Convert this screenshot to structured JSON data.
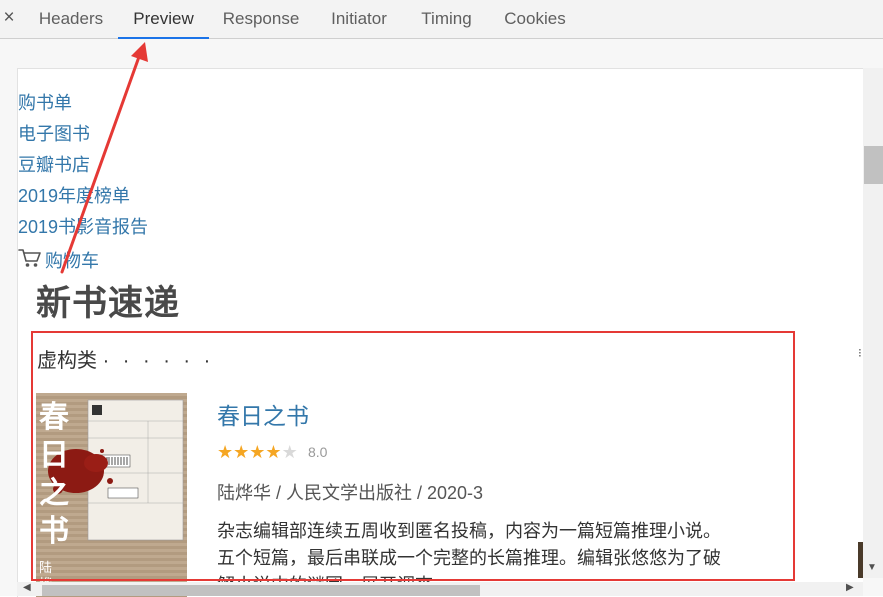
{
  "devtools": {
    "close_glyph": "×",
    "tabs": [
      {
        "label": "Headers",
        "active": false
      },
      {
        "label": "Preview",
        "active": true
      },
      {
        "label": "Response",
        "active": false
      },
      {
        "label": "Initiator",
        "active": false
      },
      {
        "label": "Timing",
        "active": false
      },
      {
        "label": "Cookies",
        "active": false
      }
    ]
  },
  "page": {
    "nav_links": [
      "购书单",
      "电子图书",
      "豆瓣书店",
      "2019年度榜单",
      "2019书影音报告"
    ],
    "cart_label": "购物车",
    "cart_icon": "shopping-cart-icon",
    "heading": "新书速递",
    "section": {
      "title": "虚构类",
      "dots": "· · · · · ·"
    },
    "book": {
      "title": "春日之书",
      "rating": "8.0",
      "stars_filled": 4,
      "stars_total": 5,
      "meta": "陆烨华 / 人民文学出版社 / 2020-3",
      "description": "杂志编辑部连续五周收到匿名投稿，内容为一篇短篇推理小说。五个短篇，最后串联成一个完整的长篇推理。编辑张悠悠为了破解小说中的谜团，展开调查……",
      "cover_text": [
        "春",
        "日",
        "之",
        "书"
      ],
      "cover_author": "陆烨"
    }
  },
  "annotation_color": "#e53935",
  "link_color": "#3377aa",
  "star_color": "#f5a623"
}
